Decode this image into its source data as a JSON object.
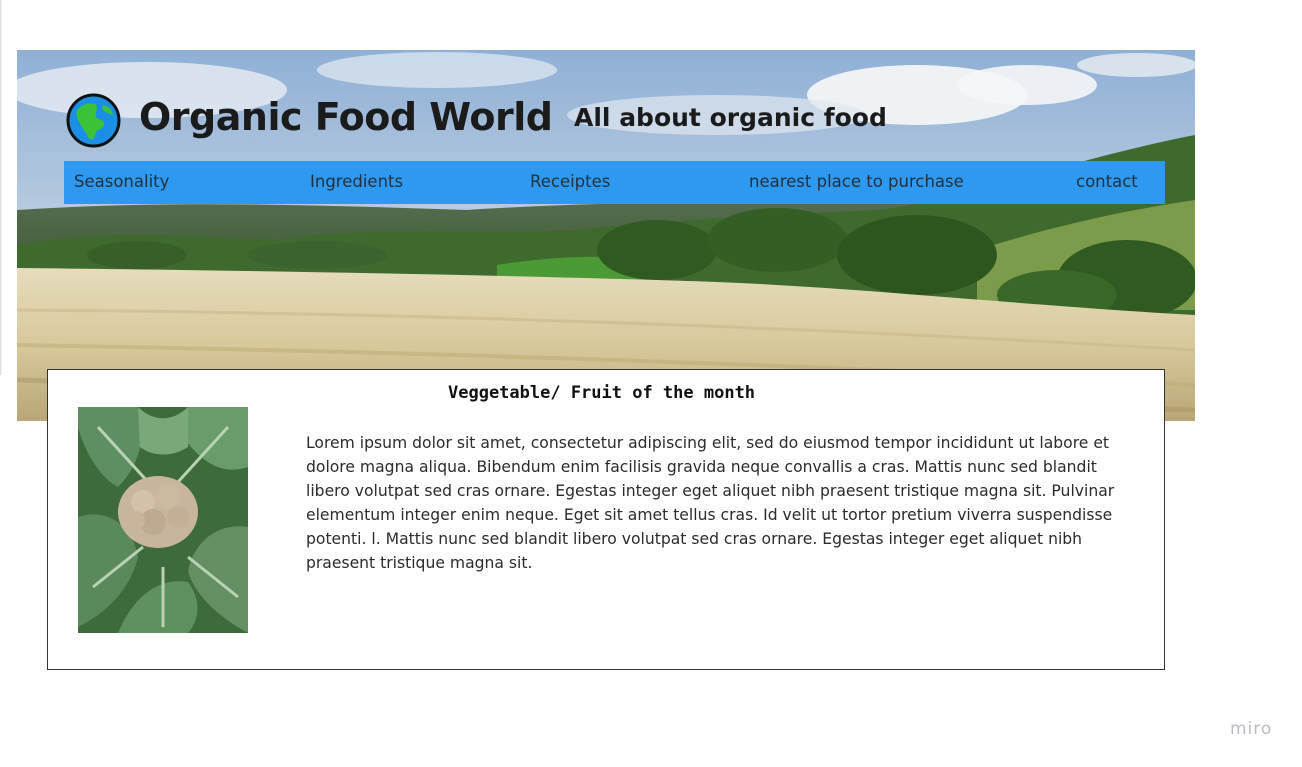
{
  "header": {
    "title": "Organic Food World",
    "tagline": "All about organic food",
    "logo_icon": "globe-americas-icon"
  },
  "nav": {
    "items": [
      {
        "label": "Seasonality"
      },
      {
        "label": "Ingredients"
      },
      {
        "label": "Receiptes"
      },
      {
        "label": "nearest place to purchase"
      },
      {
        "label": "contact"
      }
    ]
  },
  "feature": {
    "heading": "Veggetable/ Fruit of the month",
    "image": "cauliflower-photo",
    "body": "Lorem ipsum dolor sit amet, consectetur adipiscing elit, sed do eiusmod tempor incididunt ut labore et dolore magna aliqua. Bibendum enim facilisis gravida neque convallis a cras. Mattis nunc sed blandit libero volutpat sed cras ornare. Egestas integer eget aliquet nibh praesent tristique magna sit. Pulvinar elementum integer enim neque. Eget sit amet tellus cras. Id velit ut tortor pretium viverra suspendisse potenti. l. Mattis nunc sed blandit libero volutpat sed cras ornare. Egestas integer eget aliquet nibh praesent tristique magna sit."
  },
  "footer": {
    "watermark": "miro"
  },
  "colors": {
    "nav_background": "#2d99f0",
    "text": "#1b1b1b",
    "box_border": "#333333"
  }
}
